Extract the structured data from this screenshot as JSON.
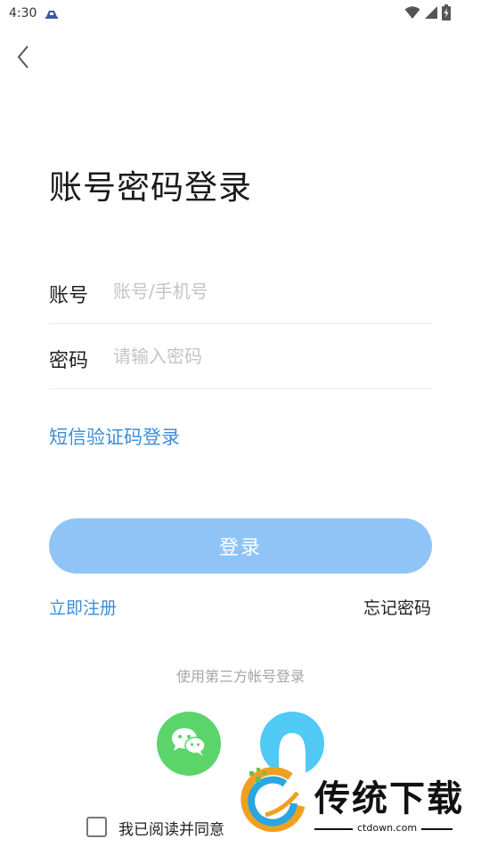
{
  "status_bar": {
    "time": "4:30",
    "notification_icon": "app-notification-icon",
    "wifi_icon": "wifi-icon",
    "signal_icon": "signal-icon",
    "battery_icon": "battery-charging-icon"
  },
  "header": {
    "back_icon": "chevron-left-icon",
    "title": "账号密码登录"
  },
  "form": {
    "account": {
      "label": "账号",
      "placeholder": "账号/手机号",
      "value": ""
    },
    "password": {
      "label": "密码",
      "placeholder": "请输入密码",
      "value": ""
    },
    "sms_login_link": "短信验证码登录",
    "login_button": "登录",
    "register_link": "立即注册",
    "forgot_password_link": "忘记密码"
  },
  "third_party": {
    "label": "使用第三方帐号登录",
    "providers": [
      {
        "name": "wechat",
        "icon": "wechat-icon",
        "color": "#5bd56a"
      },
      {
        "name": "qq",
        "icon": "qq-icon",
        "color": "#50c9f5"
      }
    ]
  },
  "agreement": {
    "text": "我已阅读并同意",
    "checked": false
  },
  "watermark": {
    "brand_text": "传统下载",
    "url": "ctdown.com"
  },
  "colors": {
    "accent": "#3d8ed8",
    "login_button_bg": "#90c4f7",
    "divider": "#ececec",
    "placeholder": "#c4c4c4"
  }
}
